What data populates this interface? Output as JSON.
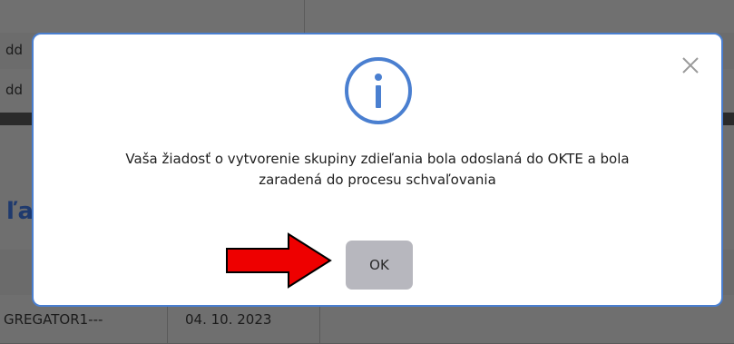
{
  "background": {
    "row1_prefix": "dd",
    "row2_prefix": "dd",
    "heading_fragment": "ľa",
    "table_row": {
      "col1": "GREGATOR1---",
      "col2": "04. 10. 2023"
    }
  },
  "modal": {
    "icon": "info-icon",
    "close_icon": "close-icon",
    "message_line1": "Vaša žiadosť o vytvorenie skupiny zdieľania bola odoslaná do OKTE a bola",
    "message_line2": "zaradená do procesu schvaľovania",
    "ok_label": "OK",
    "accent_color": "#4a7fd0"
  },
  "annotation": {
    "arrow_color": "#ee0000",
    "icon": "red-arrow-right-icon"
  }
}
